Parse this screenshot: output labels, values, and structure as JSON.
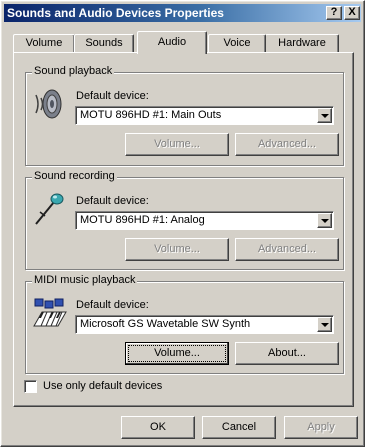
{
  "window": {
    "title": "Sounds and Audio Devices Properties",
    "help_button": "?",
    "close_button": "X"
  },
  "tabs": [
    {
      "label": "Volume",
      "active": false
    },
    {
      "label": "Sounds",
      "active": false
    },
    {
      "label": "Audio",
      "active": true
    },
    {
      "label": "Voice",
      "active": false
    },
    {
      "label": "Hardware",
      "active": false
    }
  ],
  "sound_playback": {
    "group_label": "Sound playback",
    "device_label": "Default device:",
    "device_value": "MOTU 896HD #1: Main Outs",
    "volume_button": "Volume...",
    "advanced_button": "Advanced...",
    "icon": "speaker-icon"
  },
  "sound_recording": {
    "group_label": "Sound recording",
    "device_label": "Default device:",
    "device_value": "MOTU 896HD #1: Analog",
    "volume_button": "Volume...",
    "advanced_button": "Advanced...",
    "icon": "microphone-icon"
  },
  "midi_playback": {
    "group_label": "MIDI music playback",
    "device_label": "Default device:",
    "device_value": "Microsoft GS Wavetable SW Synth",
    "volume_button": "Volume...",
    "about_button": "About...",
    "icon": "midi-keyboard-icon"
  },
  "options": {
    "use_default_only_label": "Use only default devices",
    "use_default_only_checked": false
  },
  "footer": {
    "ok": "OK",
    "cancel": "Cancel",
    "apply": "Apply"
  },
  "colors": {
    "dialog_face": "#d4d0c8",
    "title_start": "#0a246a",
    "title_end": "#a6caf0",
    "disabled_text": "#808080"
  }
}
